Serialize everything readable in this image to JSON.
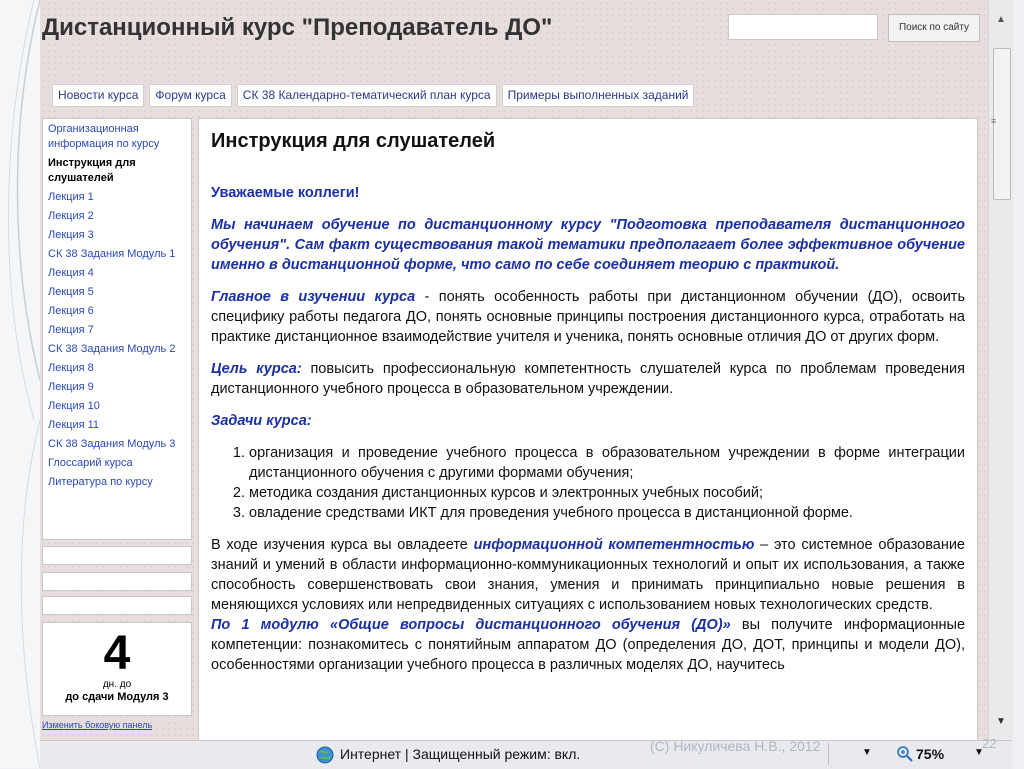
{
  "site": {
    "title": "Дистанционный курс \"Преподаватель ДО\"",
    "search_placeholder": "",
    "search_button": "Поиск по сайту"
  },
  "nav": [
    "Новости курса",
    "Форум курса",
    "СК 38 Календарно-тематический план курса",
    "Примеры выполненных заданий"
  ],
  "sidebar": {
    "items": [
      {
        "label": "Организационная информация по курсу",
        "active": false
      },
      {
        "label": "Инструкция для слушателей",
        "active": true
      },
      {
        "label": "Лекция 1",
        "active": false
      },
      {
        "label": "Лекция 2",
        "active": false
      },
      {
        "label": "Лекция 3",
        "active": false
      },
      {
        "label": "СК 38 Задания Модуль 1",
        "active": false
      },
      {
        "label": "Лекция 4",
        "active": false
      },
      {
        "label": "Лекция 5",
        "active": false
      },
      {
        "label": "Лекция 6",
        "active": false
      },
      {
        "label": "Лекция 7",
        "active": false
      },
      {
        "label": "СК 38 Задания Модуль 2",
        "active": false
      },
      {
        "label": "Лекция 8",
        "active": false
      },
      {
        "label": "Лекция 9",
        "active": false
      },
      {
        "label": "Лекция 10",
        "active": false
      },
      {
        "label": "Лекция 11",
        "active": false
      },
      {
        "label": "СК 38 Задания Модуль 3",
        "active": false
      },
      {
        "label": "Глоссарий курса",
        "active": false
      },
      {
        "label": "Литература по курсу",
        "active": false
      }
    ],
    "countdown_number": "4",
    "countdown_line1": "дн. до",
    "countdown_line2": "до сдачи Модуля 3",
    "change_panel": "Изменить боковую панель"
  },
  "content": {
    "heading": "Инструкция для слушателей",
    "greeting": "Уважаемые коллеги!",
    "intro": "Мы начинаем обучение по дистанционному курсу \"Подготовка преподавателя дистанционного обучения\". Сам факт существования такой тематики предполагает более эффективное обучение именно в дистанционной форме, что само по себе соединяет теорию с практикой.",
    "main_label": "Главное в изучении курса",
    "main_text": " - понять особенность работы при дистанционном обучении (ДО), освоить специфику работы педагога ДО, понять основные принципы построения дистанционного курса, отработать на практике дистанционное взаимодействие учителя и ученика, понять основные отличия ДО от других форм.",
    "goal_label": "Цель курса:",
    "goal_text": " повысить профессиональную компетентность слушателей курса по проблемам проведения дистанционного учебного процесса в образовательном учреждении.",
    "tasks_label": "Задачи курса:",
    "tasks": [
      "организация и проведение учебного процесса в образовательном учреждении в форме интеграции дистанционного обучения с другими формами обучения;",
      "методика создания дистанционных курсов и электронных учебных пособий;",
      "овладение средствами ИКТ для проведения учебного процесса в дистанционной форме."
    ],
    "competence_pre": "В ходе изучения курса вы овладеете ",
    "competence_term": "информационной компетентностью",
    "competence_post": " – это системное образование знаний и умений в области информационно-коммуникационных технологий и опыт их использования, а также способность совершенствовать свои знания, умения и принимать принципиально новые решения в меняющихся условиях или непредвиденных ситуациях с использованием новых технологических средств.",
    "module1_label": "По 1 модулю «Общие вопросы дистанционного обучения (ДО)»",
    "module1_text": " вы получите информационные компетенции: познакомитесь с понятийным аппаратом ДО (определения ДО, ДОТ, принципы и модели ДО), особенностями организации учебного процесса в различных моделях ДО, научитесь"
  },
  "status": {
    "zone": "Интернет | Защищенный режим: вкл.",
    "zoom": "75%"
  },
  "slide": {
    "footer": "(С) Никуличева Н.В., 2012",
    "number": "22"
  }
}
